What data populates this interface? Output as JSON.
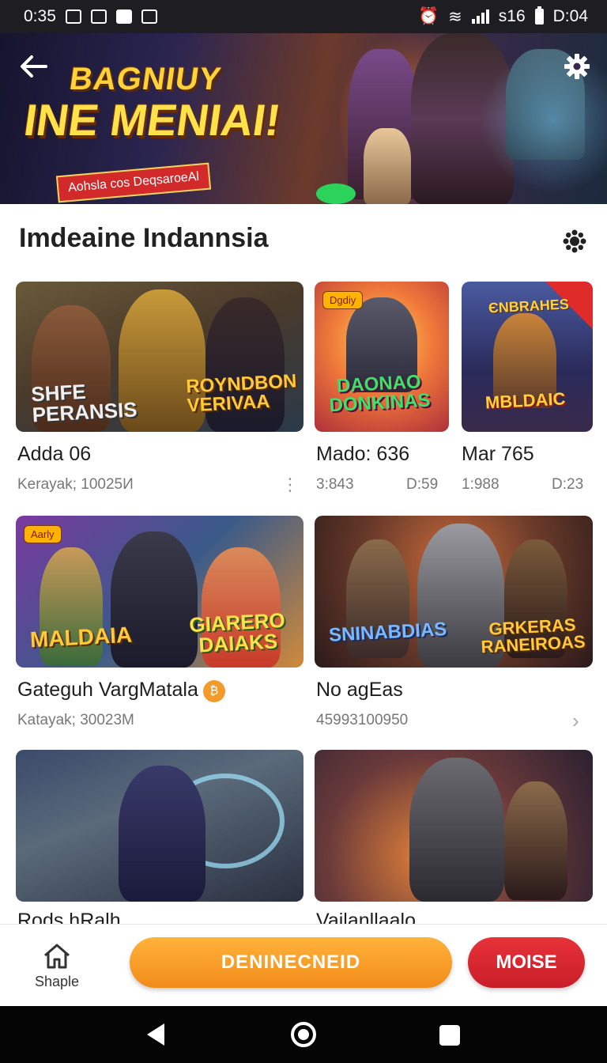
{
  "status_bar": {
    "time": "0:35",
    "carrier": "s16",
    "battery_time": "D:04"
  },
  "hero": {
    "back_icon": "arrow-left-icon",
    "settings_icon": "gear-icon",
    "title_line1": "BAGNIUY",
    "title_line2": "INE MENIAI!",
    "tagline": "Aohsla cos DeqsaroeAl"
  },
  "section": {
    "title": "Imdeaine Indannsia",
    "icon": "gear-icon"
  },
  "cards": [
    {
      "title": "Adda 06",
      "subtitle": "Kerayak; 10025И",
      "art_left": "SHFE\nPERANSIS",
      "art_right": "ROYNDBON\nVERIVAA"
    },
    {
      "title": "Mado: 636",
      "meta_left": "3:843",
      "meta_right": "D:59",
      "badge": "Dgdiy",
      "art": "DAONAO\nDONKINAS"
    },
    {
      "title": "Mar 765",
      "meta_left": "1:988",
      "meta_right": "D:23",
      "art": "MBLDAIC",
      "art_top": "ЄNBRAHES"
    },
    {
      "title": "Gateguh VargMatala",
      "coin": "₿",
      "subtitle": "Katayak; 30023M",
      "badge": "Aarly",
      "art_left": "MALDAIA",
      "art_right": "GIARERO\nDAIAKS"
    },
    {
      "title": "No agEas",
      "subtitle": "45993100950",
      "art_left": "SNINABDIAS",
      "art_right": "GRKERAS\nRANEIROAS"
    },
    {
      "title": "Rods hRalh"
    },
    {
      "title": "Vailanllaalo"
    }
  ],
  "action_bar": {
    "home_label": "Shaple",
    "primary_label": "DENINECNEID",
    "secondary_label": "MOISE"
  },
  "colors": {
    "primary": "#f59b22",
    "secondary": "#d8262f",
    "banner_title": "#ffd23a"
  }
}
